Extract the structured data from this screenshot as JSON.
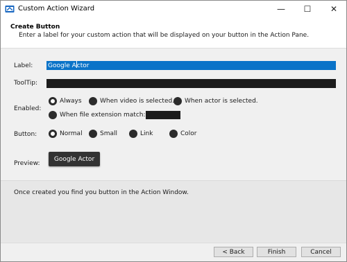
{
  "window": {
    "title": "Custom Action Wizard",
    "icon": "app-window-icon",
    "controls": {
      "minimize": "—",
      "maximize": "☐",
      "close": "✕"
    }
  },
  "header": {
    "title": "Create Button",
    "description": "Enter a label for your custom action that will be displayed on your button in the Action Pane."
  },
  "form": {
    "label": {
      "caption": "Label:",
      "value_before_caret": "Google A",
      "value_after_caret": "ctor"
    },
    "tooltip": {
      "caption": "ToolTip:",
      "value": ""
    },
    "enabled": {
      "caption": "Enabled:",
      "options": [
        "Always",
        "When video is selected.",
        "When actor is selected.",
        "When file extension match:"
      ],
      "selected": "Always"
    },
    "button": {
      "caption": "Button:",
      "options": [
        "Normal",
        "Small",
        "Link",
        "Color"
      ],
      "selected": "Normal"
    },
    "preview": {
      "caption": "Preview:",
      "button_label": "Google Actor"
    }
  },
  "info": {
    "text": "Once created you find you button in the Action Window."
  },
  "footer": {
    "back": "< Back",
    "finish": "Finish",
    "cancel": "Cancel"
  },
  "colors": {
    "selection": "#0a73c8",
    "dark_field": "#1c1c1c",
    "preview_bg": "#333333"
  }
}
